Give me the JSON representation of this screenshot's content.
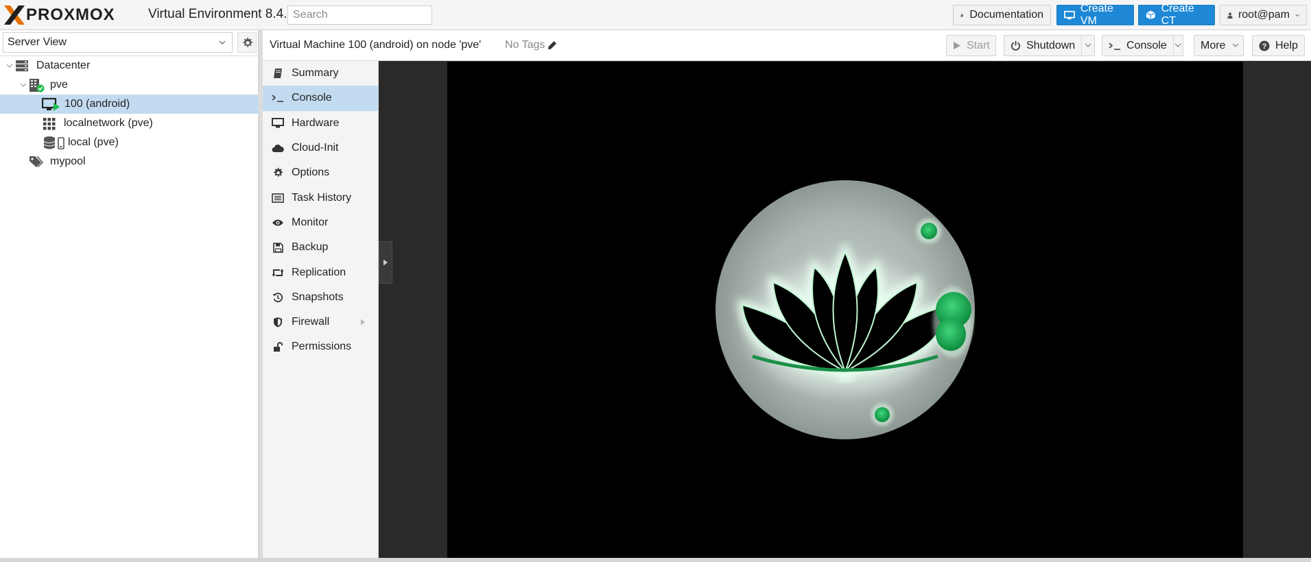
{
  "header": {
    "brand": "PROXMOX",
    "product": "Virtual Environment 8.4.1",
    "search_placeholder": "Search",
    "buttons": {
      "documentation": "Documentation",
      "create_vm": "Create VM",
      "create_ct": "Create CT",
      "user": "root@pam"
    }
  },
  "tree_panel": {
    "view": "Server View",
    "nodes": [
      {
        "label": "Datacenter",
        "icon": "server-stack-icon"
      },
      {
        "label": "pve",
        "icon": "node-online-icon"
      },
      {
        "label": "100 (android)",
        "icon": "vm-running-icon",
        "selected": true
      },
      {
        "label": "localnetwork (pve)",
        "icon": "sdn-grid-icon"
      },
      {
        "label": "local (pve)",
        "icon": "storage-icon"
      },
      {
        "label": "mypool",
        "icon": "tags-icon"
      }
    ]
  },
  "titlebar": {
    "title": "Virtual Machine 100 (android) on node 'pve'",
    "tags": "No Tags",
    "buttons": {
      "start": "Start",
      "shutdown": "Shutdown",
      "console": "Console",
      "more": "More",
      "help": "Help"
    }
  },
  "nav": {
    "items": [
      {
        "label": "Summary",
        "icon": "book-icon"
      },
      {
        "label": "Console",
        "icon": "terminal-icon",
        "selected": true
      },
      {
        "label": "Hardware",
        "icon": "monitor-icon"
      },
      {
        "label": "Cloud-Init",
        "icon": "cloud-icon"
      },
      {
        "label": "Options",
        "icon": "gear-icon"
      },
      {
        "label": "Task History",
        "icon": "list-icon"
      },
      {
        "label": "Monitor",
        "icon": "eye-icon"
      },
      {
        "label": "Backup",
        "icon": "floppy-icon"
      },
      {
        "label": "Replication",
        "icon": "retweet-icon"
      },
      {
        "label": "Snapshots",
        "icon": "history-icon"
      },
      {
        "label": "Firewall",
        "icon": "shield-icon"
      },
      {
        "label": "Permissions",
        "icon": "unlock-icon"
      }
    ]
  },
  "colors": {
    "accent_blue": "#1e88d6",
    "brand_orange": "#e57000",
    "selection": "#c3dbf0",
    "status_green": "#21bf4b"
  }
}
